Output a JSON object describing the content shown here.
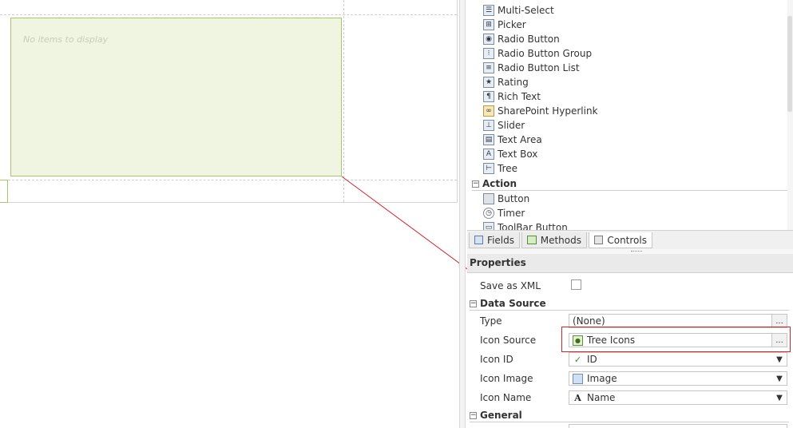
{
  "canvas": {
    "tree_empty_text": "No items to display"
  },
  "toolbox": {
    "items_top": [
      {
        "label": "Multi-Select",
        "icon": "multi-select-icon"
      },
      {
        "label": "Picker",
        "icon": "picker-icon"
      },
      {
        "label": "Radio Button",
        "icon": "radio-button-icon"
      },
      {
        "label": "Radio Button Group",
        "icon": "radio-button-group-icon"
      },
      {
        "label": "Radio Button List",
        "icon": "radio-button-list-icon"
      },
      {
        "label": "Rating",
        "icon": "rating-star-icon"
      },
      {
        "label": "Rich Text",
        "icon": "rich-text-icon"
      },
      {
        "label": "SharePoint Hyperlink",
        "icon": "sharepoint-hyperlink-icon"
      },
      {
        "label": "Slider",
        "icon": "slider-icon"
      },
      {
        "label": "Text Area",
        "icon": "text-area-icon"
      },
      {
        "label": "Text Box",
        "icon": "text-box-icon"
      },
      {
        "label": "Tree",
        "icon": "tree-icon"
      }
    ],
    "action_section": "Action",
    "action_items": [
      {
        "label": "Button",
        "icon": "button-icon"
      },
      {
        "label": "Timer",
        "icon": "timer-icon"
      },
      {
        "label": "ToolBar Button",
        "icon": "toolbar-button-icon"
      }
    ],
    "expander_symbol": "−"
  },
  "tabs": [
    {
      "label": "Fields",
      "icon": "fields-icon",
      "active": false
    },
    {
      "label": "Methods",
      "icon": "methods-icon",
      "active": false
    },
    {
      "label": "Controls",
      "icon": "controls-icon",
      "active": true
    }
  ],
  "properties": {
    "header": "Properties",
    "save_as_xml_label": "Save as XML",
    "save_as_xml_checked": false,
    "data_source_section": "Data Source",
    "type_label": "Type",
    "type_value": "(None)",
    "icon_source_label": "Icon Source",
    "icon_source_value": "Tree Icons",
    "icon_id_label": "Icon ID",
    "icon_id_value": "ID",
    "icon_image_label": "Icon Image",
    "icon_image_value": "Image",
    "icon_name_label": "Icon Name",
    "icon_name_value": "Name",
    "general_section": "General",
    "ellipsis": "...",
    "dropdown_arrow": "▼"
  },
  "colors": {
    "tree_background": "#f0f5e2",
    "tree_border": "#a9c46a",
    "highlight": "#d0272b"
  }
}
